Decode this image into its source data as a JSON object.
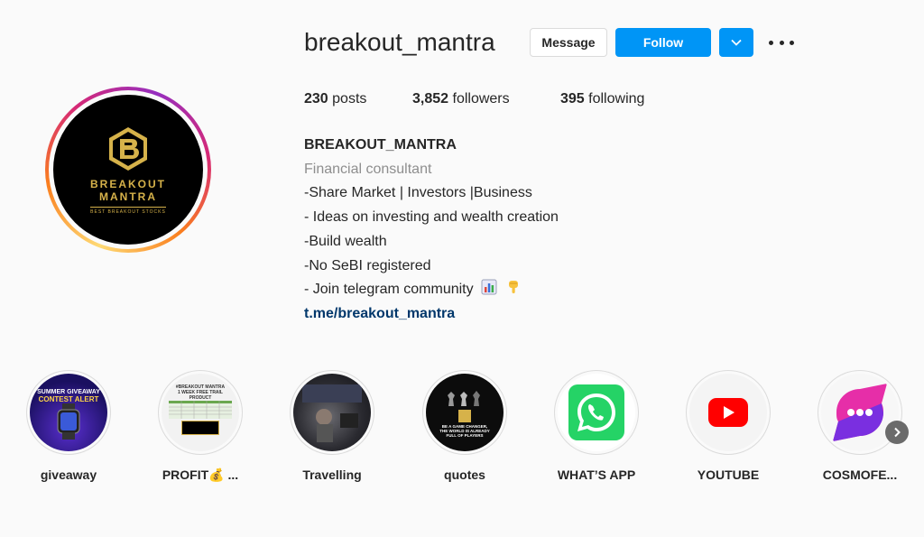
{
  "profile": {
    "username": "breakout_mantra",
    "avatar": {
      "brand_line1": "BREAKOUT",
      "brand_line2": "MANTRA",
      "tagline": "BEST BREAKOUT STOCKS",
      "colors": {
        "background": "#000000",
        "gold": "#d6b24a"
      }
    }
  },
  "actions": {
    "message_label": "Message",
    "follow_label": "Follow",
    "dropdown_icon": "chevron-down-icon",
    "more_icon": "more-options-icon"
  },
  "stats": {
    "posts_count": "230",
    "posts_label": "posts",
    "followers_count": "3,852",
    "followers_label": "followers",
    "following_count": "395",
    "following_label": "following"
  },
  "bio": {
    "full_name": "BREAKOUT_MANTRA",
    "category": "Financial consultant",
    "lines": [
      "-Share Market | Investors |Business",
      "- Ideas on investing and wealth creation",
      "-Build wealth",
      "-No SeBI registered",
      "- Join telegram community"
    ],
    "line_emojis": [
      "bar-chart-icon",
      "pointing-down-icon"
    ],
    "link": "t.me/breakout_mantra"
  },
  "highlights": [
    {
      "label": "giveaway",
      "thumb_text": [
        "SUMMER GIVEAWAY",
        "CONTEST ALERT"
      ]
    },
    {
      "label": "PROFIT💰 ...",
      "thumb_text": [
        "#BREAKOUT MANTRA",
        "1 WEEK FREE TRAIL",
        "PRODUCT"
      ]
    },
    {
      "label": "Travelling"
    },
    {
      "label": "quotes",
      "thumb_text": [
        "BE A GAME CHANGER,",
        "THE WORLD IS ALREADY",
        "FULL OF PLAYERS"
      ]
    },
    {
      "label": "WHAT’S APP"
    },
    {
      "label": "YOUTUBE"
    },
    {
      "label": "COSMOFE..."
    }
  ],
  "colors": {
    "follow_blue": "#0095f6",
    "link_blue": "#00376b",
    "text": "#262626",
    "muted": "#8e8e8e",
    "whatsapp_green": "#25d366",
    "youtube_red": "#ff0000"
  }
}
